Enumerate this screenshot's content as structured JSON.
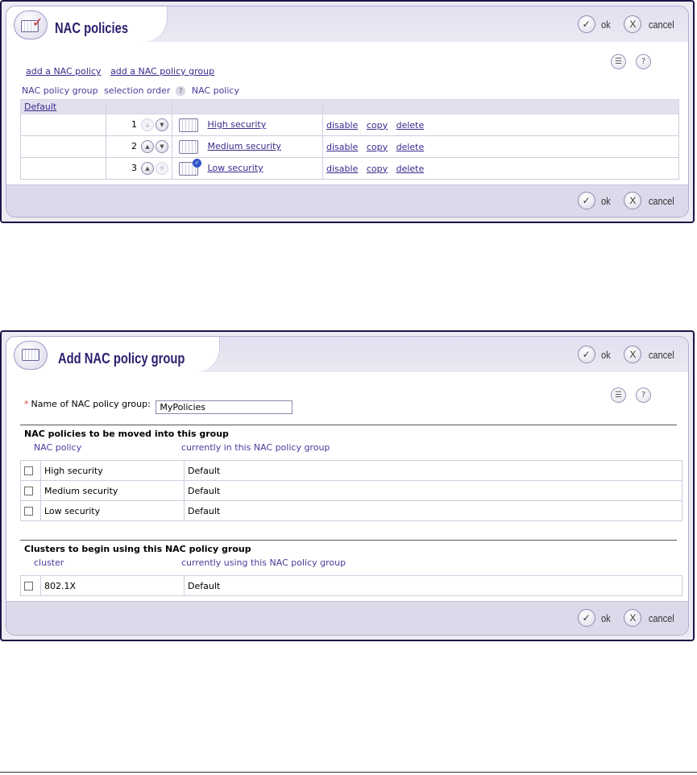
{
  "panel1": {
    "title": "NAC policies",
    "ok_label": "ok",
    "cancel_label": "cancel",
    "ok_glyph": "✓",
    "cancel_glyph": "X",
    "list_icon_glyph": "☰",
    "help_icon_glyph": "?",
    "add_policy_link": "add a NAC policy",
    "add_group_link": "add a NAC policy group",
    "columns": {
      "group": "NAC policy group",
      "order": "selection order",
      "policy": "NAC policy"
    },
    "group_name": "Default",
    "rows": [
      {
        "order": "1",
        "name": "High security",
        "disable": "disable",
        "copy": "copy",
        "delete": "delete"
      },
      {
        "order": "2",
        "name": "Medium security",
        "disable": "disable",
        "copy": "copy",
        "delete": "delete"
      },
      {
        "order": "3",
        "name": "Low security",
        "disable": "disable",
        "copy": "copy",
        "delete": "delete"
      }
    ]
  },
  "panel2": {
    "title": "Add NAC policy group",
    "ok_label": "ok",
    "cancel_label": "cancel",
    "ok_glyph": "✓",
    "cancel_glyph": "X",
    "list_icon_glyph": "☰",
    "help_icon_glyph": "?",
    "required_marker": "*",
    "name_label": "Name of NAC policy group:",
    "name_value": "MyPolicies",
    "policies_section": {
      "title": "NAC policies to be moved into this group",
      "col_name": "NAC policy",
      "col_current": "currently in this NAC policy group",
      "rows": [
        {
          "name": "High security",
          "current": "Default"
        },
        {
          "name": "Medium security",
          "current": "Default"
        },
        {
          "name": "Low security",
          "current": "Default"
        }
      ]
    },
    "clusters_section": {
      "title": "Clusters to begin using this NAC policy group",
      "col_name": "cluster",
      "col_current": "currently using this NAC policy group",
      "rows": [
        {
          "name": "802.1X",
          "current": "Default"
        }
      ]
    }
  },
  "colors": {
    "frame": "#1d1446",
    "title": "#2a1f6e",
    "link": "#3a2a8c",
    "header_band": "#e2e0ee",
    "footer_band": "#dcdaea",
    "required": "#d23b3b"
  }
}
